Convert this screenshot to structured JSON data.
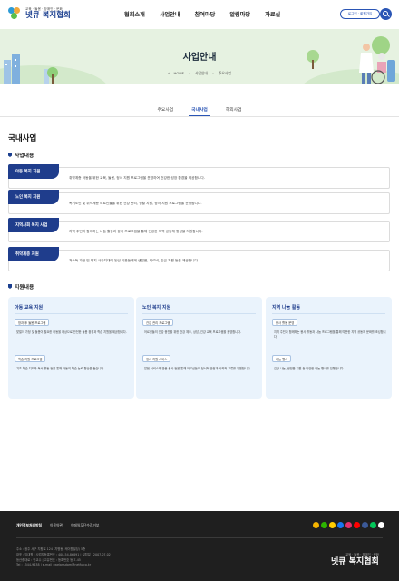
{
  "header": {
    "logo_tagline": "교육 · 돌봄 · 장애인 · 문화",
    "logo_name": "넷큐 복지협회",
    "nav": [
      "협회소개",
      "사업안내",
      "참여마당",
      "알림마당",
      "자료실"
    ],
    "login_button": "로그인 · 회원가입"
  },
  "hero": {
    "title": "사업안내",
    "breadcrumb": [
      "HOME",
      "사업안내",
      "주요사업"
    ]
  },
  "subtabs": {
    "items": [
      "주요사업",
      "국내사업",
      "해외사업"
    ],
    "active": "국내사업"
  },
  "domestic": {
    "title": "국내사업",
    "business_heading": "사업내용",
    "items": [
      {
        "label": "아동 복지 지원",
        "desc": "취약계층 아동을 위한 교육, 돌봄, 정서 지원 프로그램을 운영하여 건강한 성장 환경을 제공합니다."
      },
      {
        "label": "노인 복지 지원",
        "desc": "독거노인 및 취약계층 어르신들을 위한 건강 관리, 생활 지원, 정서 지원 프로그램을 운영합니다."
      },
      {
        "label": "지역사회 복지 사업",
        "desc": "지역 주민과 함께하는 나눔 활동과 봉사 프로그램을 통해 건강한 지역 공동체 형성을 지원합니다."
      },
      {
        "label": "취약계층 지원",
        "desc": "저소득 가정 및 복지 사각지대에 놓인 이웃들에게 생필품, 의료비, 긴급 지원 등을 제공합니다."
      }
    ]
  },
  "support": {
    "heading": "지원내용",
    "cards": [
      {
        "title": "아동 교육 지원",
        "blocks": [
          {
            "chip": "방과 후 돌봄 프로그램",
            "text": "맞벌이 가정 및 돌봄이 필요한 아동을 대상으로 안전한 돌봄 환경과 학습 지원을 제공합니다."
          },
          {
            "chip": "학습 지원 프로그램",
            "text": "기초 학습 지도와 독서 활동 등을 통해 아동의 학습 능력 향상을 돕습니다."
          }
        ]
      },
      {
        "title": "노인 복지 지원",
        "blocks": [
          {
            "chip": "건강 관리 프로그램",
            "text": "어르신들의 건강 증진을 위한 건강 체조, 상담, 건강 교육 프로그램을 운영합니다."
          },
          {
            "chip": "정서 지원 서비스",
            "text": "말벗 서비스와 방문 봉사 등을 통해 어르신들의 정서적 안정과 사회적 교류를 지원합니다."
          }
        ]
      },
      {
        "title": "지역 나눔 활동",
        "blocks": [
          {
            "chip": "봉사 활동 운영",
            "text": "지역 주민과 함께하는 봉사 활동과 나눔 프로그램을 통해 따뜻한 지역 공동체 문화를 조성합니다."
          },
          {
            "chip": "나눔 행사",
            "text": "김장 나눔, 생필품 지원 등 다양한 나눔 행사를 진행합니다."
          }
        ]
      }
    ]
  },
  "footer": {
    "links": [
      "개인정보처리방침",
      "이용약관",
      "이메일무단수집거부"
    ],
    "info": [
      "주소 : 광주 서구 치평로 124 (치평동, 케이원빌딩) 5층",
      "대표 : 임대원 | 사업자등록번호 : 408-54-86891 | 설립일 : 2007.07.02",
      "등산중대로 : 안교수 | 고유번호 : 등록번호 등-7-45",
      "Tel : 1544-9638 | e-mail : welansdom@netfu.co.kr"
    ],
    "logo_tagline": "교육 · 돌봄 · 장애인 · 문화",
    "logo_name": "넷큐 복지협회",
    "colors": {
      "background": "#1f1f1f",
      "accent": "#1f3d8c"
    }
  }
}
